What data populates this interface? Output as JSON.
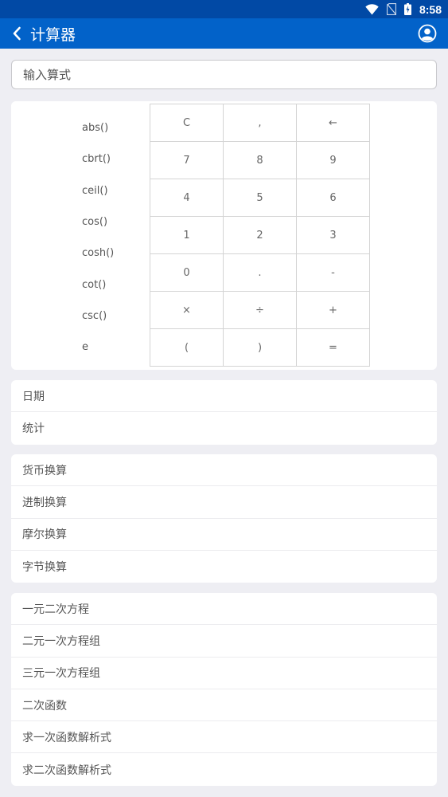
{
  "status_bar": {
    "time": "8:58"
  },
  "app_bar": {
    "title": "计算器"
  },
  "input": {
    "placeholder": "输入算式",
    "value": ""
  },
  "functions": [
    "abs()",
    "cbrt()",
    "ceil()",
    "cos()",
    "cosh()",
    "cot()",
    "csc()",
    "e"
  ],
  "keypad": {
    "keys": [
      "C",
      ",",
      "←",
      "7",
      "8",
      "9",
      "4",
      "5",
      "6",
      "1",
      "2",
      "3",
      "0",
      ".",
      "-",
      "×",
      "÷",
      "+",
      "(",
      ")",
      "="
    ]
  },
  "menu_group1": [
    "日期",
    "统计"
  ],
  "menu_group2": [
    "货币换算",
    "进制换算",
    "摩尔换算",
    "字节换算"
  ],
  "menu_group3": [
    "一元二次方程",
    "二元一次方程组",
    "三元一次方程组",
    "二次函数",
    "求一次函数解析式",
    "求二次函数解析式"
  ],
  "colors": {
    "status_bar": "#0149a5",
    "app_bar": "#0262c9",
    "background": "#eeeef3"
  }
}
